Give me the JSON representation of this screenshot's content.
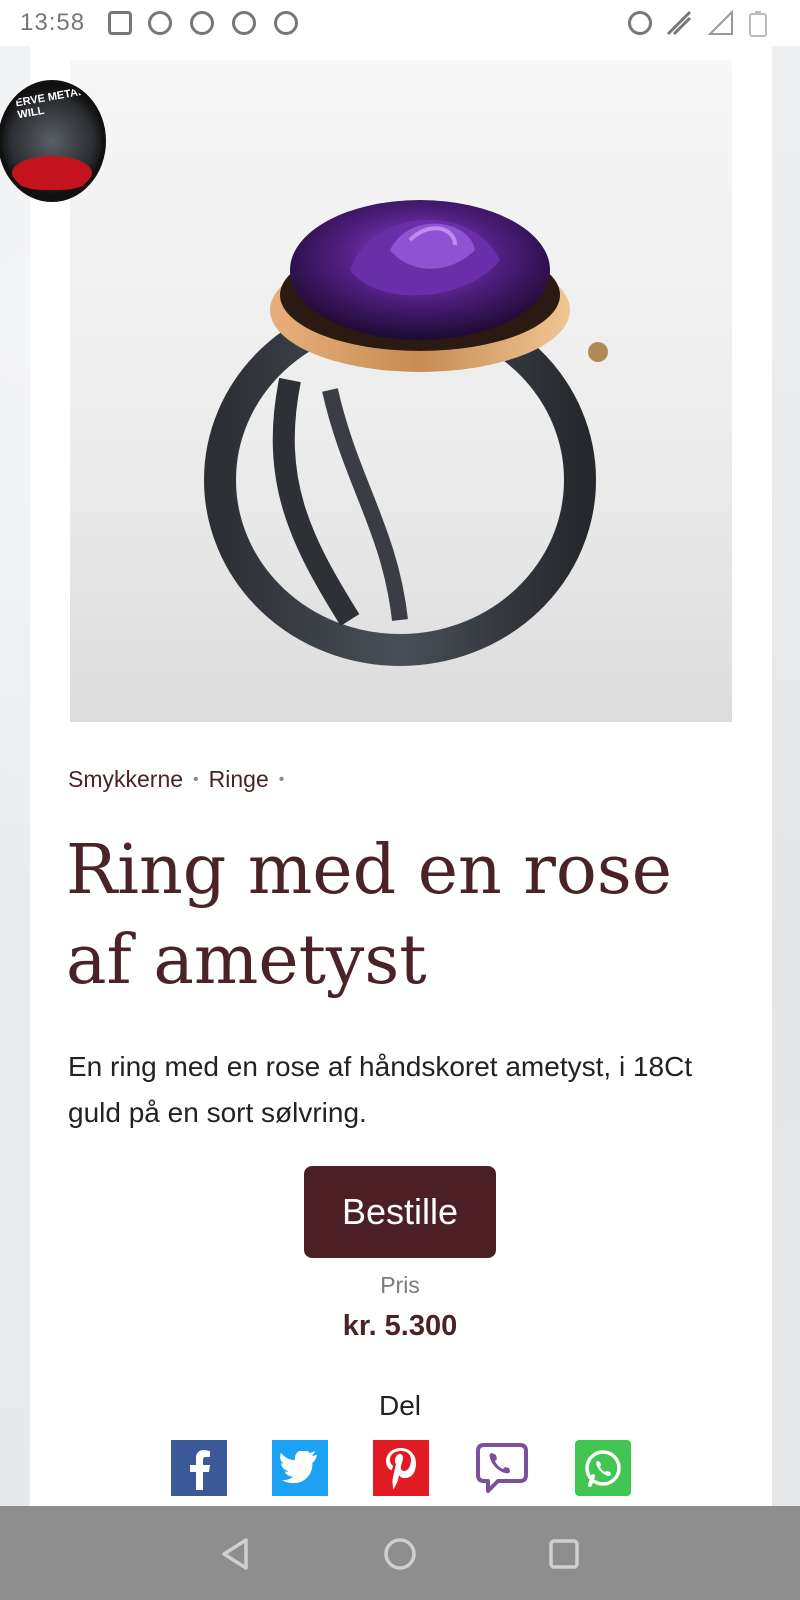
{
  "status_bar": {
    "time": "13:58"
  },
  "product": {
    "breadcrumb": [
      "Smykkerne",
      "Ringe"
    ],
    "title": "Ring med en rose af ametyst",
    "description": "En ring med en rose af håndskoret ametyst, i 18Ct guld på en sort sølvring.",
    "order_label": "Bestille",
    "price_label": "Pris",
    "price": "kr. 5.300"
  },
  "share": {
    "label": "Del",
    "buttons": [
      {
        "name": "facebook",
        "icon": "facebook-icon",
        "color": "#3b5998"
      },
      {
        "name": "twitter",
        "icon": "twitter-icon",
        "color": "#1da1f2"
      },
      {
        "name": "pinterest",
        "icon": "pinterest-icon",
        "color": "#e01b24"
      },
      {
        "name": "viber",
        "icon": "viber-icon",
        "color": "#7b519d"
      },
      {
        "name": "whatsapp",
        "icon": "whatsapp-icon",
        "color": "#43c553"
      }
    ]
  },
  "avatar": {
    "text": "ERVE METAL WILL"
  },
  "nav": {
    "icons": [
      "back-icon",
      "home-icon",
      "recents-icon"
    ]
  },
  "colors": {
    "brand": "#4c1f25",
    "title": "#4a2227"
  }
}
